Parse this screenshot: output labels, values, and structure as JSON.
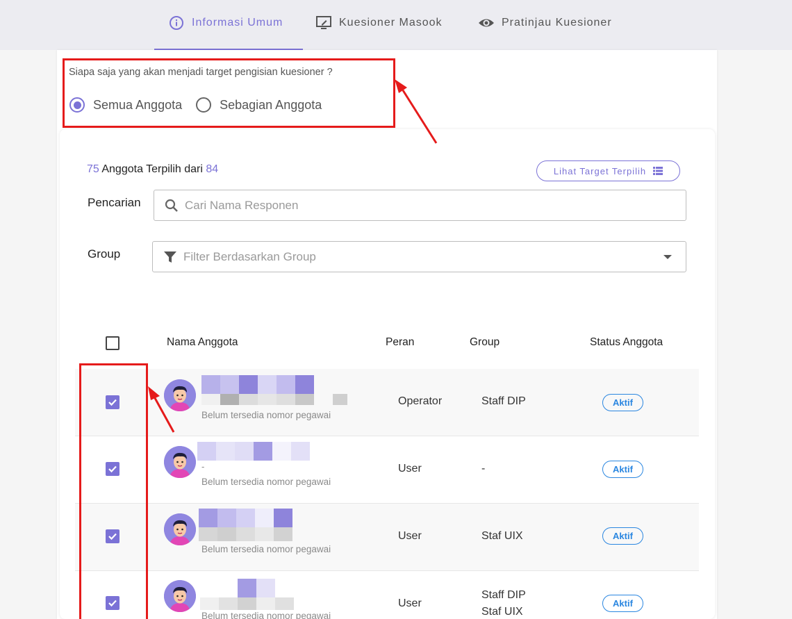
{
  "tabs": [
    {
      "label": "Informasi Umum",
      "icon": "info-circle-icon",
      "active": true
    },
    {
      "label": "Kuesioner Masook",
      "icon": "monitor-edit-icon",
      "active": false
    },
    {
      "label": "Pratinjau Kuesioner",
      "icon": "eye-icon",
      "active": false
    }
  ],
  "target": {
    "question": "Siapa saja yang akan menjadi target pengisian kuesioner ?",
    "options": [
      {
        "label": "Semua Anggota",
        "selected": true
      },
      {
        "label": "Sebagian Anggota",
        "selected": false
      }
    ]
  },
  "summary": {
    "selected": "75",
    "text": "Anggota Terpilih dari",
    "total": "84",
    "view_button": "Lihat Target Terpilih"
  },
  "search": {
    "label": "Pencarian",
    "placeholder": "Cari Nama Responen"
  },
  "group_filter": {
    "label": "Group",
    "placeholder": "Filter Berdasarkan Group"
  },
  "table": {
    "headers": {
      "name": "Nama Anggota",
      "role": "Peran",
      "group": "Group",
      "status": "Status Anggota"
    },
    "rows": [
      {
        "checked": true,
        "sub": "",
        "nip": "Belum tersedia nomor pegawai",
        "role": "Operator",
        "group": "Staff DIP",
        "group2": "",
        "status": "Aktif"
      },
      {
        "checked": true,
        "sub": "-",
        "nip": "Belum tersedia nomor pegawai",
        "role": "User",
        "group": "-",
        "group2": "",
        "status": "Aktif"
      },
      {
        "checked": true,
        "sub": "",
        "nip": "Belum tersedia nomor pegawai",
        "role": "User",
        "group": "Staf UIX",
        "group2": "",
        "status": "Aktif"
      },
      {
        "checked": true,
        "sub": "",
        "nip": "Belum tersedia nomor pegawai",
        "role": "User",
        "group": "Staff DIP",
        "group2": "Staf UIX",
        "status": "Aktif"
      }
    ]
  },
  "colors": {
    "accent": "#7b72d6",
    "annotation": "#e51b1b",
    "status": "#2a86e0"
  }
}
